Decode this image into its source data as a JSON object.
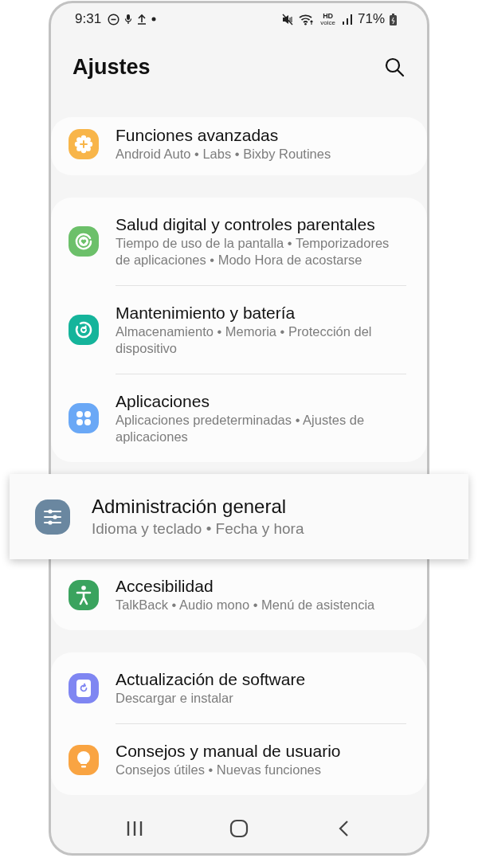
{
  "status_bar": {
    "time": "9:31",
    "hd_label": "HD",
    "voice_label": "voice",
    "battery": "71%"
  },
  "header": {
    "title": "Ajustes"
  },
  "groups": [
    {
      "items": [
        {
          "kind": "features",
          "color": "#f8b549",
          "title": "Funciones avanzadas",
          "subtitle": "Android Auto • Labs • Bixby Routines",
          "highlighted": false
        }
      ]
    },
    {
      "items": [
        {
          "kind": "wellbeing",
          "color": "#6cc06a",
          "title": "Salud digital y controles parentales",
          "subtitle": "Tiempo de uso de la pantalla • Temporizadores de aplicaciones • Modo Hora de acostarse",
          "highlighted": false
        },
        {
          "kind": "maintenance",
          "color": "#15b49b",
          "title": "Mantenimiento y batería",
          "subtitle": "Almacenamiento • Memoria • Protección del dispositivo",
          "highlighted": false
        },
        {
          "kind": "apps",
          "color": "#6aa8f6",
          "title": "Aplicaciones",
          "subtitle": "Aplicaciones predeterminadas • Ajustes de aplicaciones",
          "highlighted": false
        }
      ]
    },
    {
      "items": [
        {
          "kind": "general",
          "color": "#6a87a0",
          "title": "Administración general",
          "subtitle": "Idioma y teclado • Fecha y hora",
          "highlighted": true
        },
        {
          "kind": "accessibility",
          "color": "#3aa35e",
          "title": "Accesibilidad",
          "subtitle": "TalkBack • Audio mono • Menú de asistencia",
          "highlighted": false
        }
      ]
    },
    {
      "items": [
        {
          "kind": "update",
          "color": "#7f86f2",
          "title": "Actualización de software",
          "subtitle": "Descargar e instalar",
          "highlighted": false
        },
        {
          "kind": "tips",
          "color": "#f9a442",
          "title": "Consejos y manual de usuario",
          "subtitle": "Consejos útiles • Nuevas funciones",
          "highlighted": false
        }
      ]
    }
  ]
}
